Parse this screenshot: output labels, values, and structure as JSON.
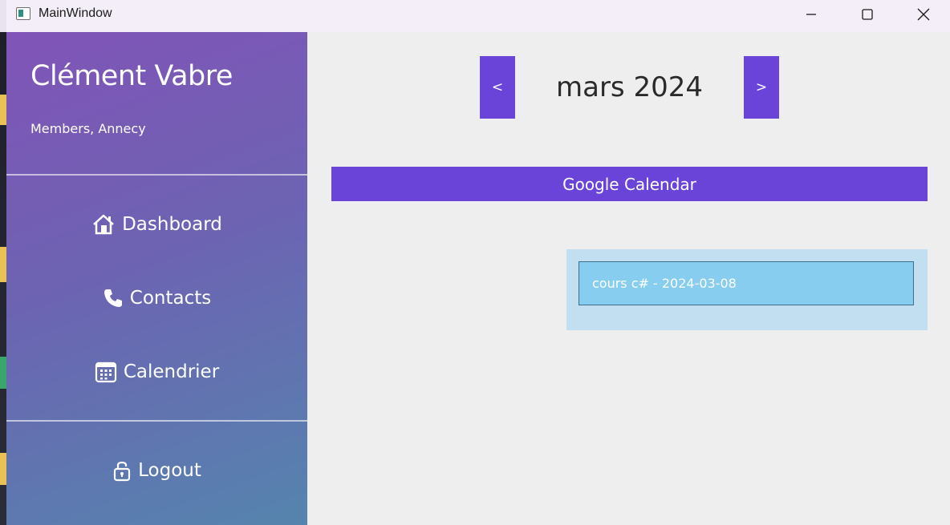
{
  "window": {
    "title": "MainWindow",
    "app_icon": "window-app-icon",
    "controls": [
      "minimize-icon",
      "maximize-icon",
      "close-icon"
    ]
  },
  "sidebar": {
    "user_name": "Clément Vabre",
    "user_sub": "Members, Annecy",
    "items": [
      {
        "label": "Dashboard",
        "icon": "home-icon"
      },
      {
        "label": "Contacts",
        "icon": "phone-icon"
      },
      {
        "label": "Calendrier",
        "icon": "calendar-icon"
      }
    ],
    "logout": {
      "label": "Logout",
      "icon": "lock-icon"
    }
  },
  "calendar": {
    "prev_label": "<",
    "next_label": ">",
    "month": "mars 2024",
    "google_button": "Google Calendar",
    "events": [
      {
        "label": "cours c# - 2024-03-08"
      }
    ]
  },
  "colors": {
    "accent": "#6a44d8",
    "event_bg": "#87cdf0",
    "event_panel_bg": "#c2dff2",
    "main_bg": "#eeeeee"
  }
}
